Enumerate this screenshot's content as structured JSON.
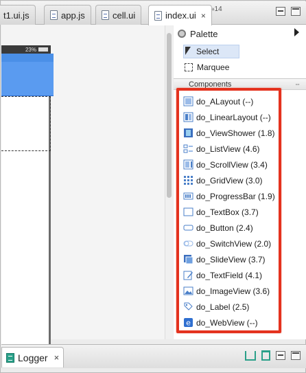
{
  "tabs": [
    {
      "label": "t1.ui.js",
      "icon": "js-file-icon",
      "active": false
    },
    {
      "label": "app.js",
      "icon": "js-file-icon",
      "active": false
    },
    {
      "label": "cell.ui",
      "icon": "ui-file-icon",
      "active": false
    },
    {
      "label": "index.ui",
      "icon": "ui-file-icon",
      "active": true,
      "close": "×"
    }
  ],
  "tab_overflow": "»14",
  "editor": {
    "status_text": "23%"
  },
  "palette": {
    "title": "Palette",
    "tools": [
      {
        "label": "Select",
        "icon": "cursor-icon",
        "selected": true
      },
      {
        "label": "Marquee",
        "icon": "marquee-icon",
        "selected": false
      }
    ],
    "components_header": "Components",
    "components": [
      {
        "label": "do_ALayout (--)",
        "icon": "alayout-icon"
      },
      {
        "label": "do_LinearLayout (--)",
        "icon": "linearlayout-icon"
      },
      {
        "label": "do_ViewShower (1.8)",
        "icon": "viewshower-icon"
      },
      {
        "label": "do_ListView (4.6)",
        "icon": "listview-icon"
      },
      {
        "label": "do_ScrollView (3.4)",
        "icon": "scrollview-icon"
      },
      {
        "label": "do_GridView (3.0)",
        "icon": "gridview-icon"
      },
      {
        "label": "do_ProgressBar (1.9)",
        "icon": "progressbar-icon"
      },
      {
        "label": "do_TextBox (3.7)",
        "icon": "textbox-icon"
      },
      {
        "label": "do_Button (2.4)",
        "icon": "button-icon"
      },
      {
        "label": "do_SwitchView (2.0)",
        "icon": "switchview-icon"
      },
      {
        "label": "do_SlideView (3.7)",
        "icon": "slideview-icon"
      },
      {
        "label": "do_TextField (4.1)",
        "icon": "textfield-icon"
      },
      {
        "label": "do_ImageView (3.6)",
        "icon": "imageview-icon"
      },
      {
        "label": "do_Label (2.5)",
        "icon": "label-icon"
      },
      {
        "label": "do_WebView (--)",
        "icon": "webview-icon"
      }
    ]
  },
  "bottom": {
    "tab_label": "Logger",
    "tab_close": "×"
  },
  "colors": {
    "highlight": "#e4321e",
    "icon_blue": "#4a7fc8",
    "accent_teal": "#2aa089",
    "phone_blue": "#5a9bf0"
  }
}
